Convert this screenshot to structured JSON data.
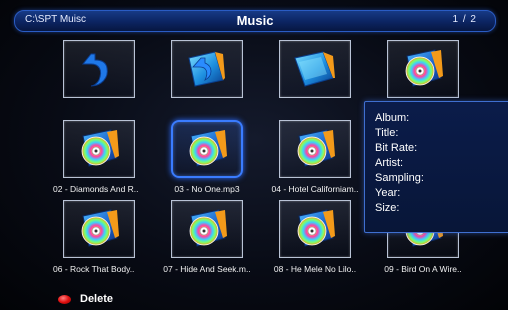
{
  "header": {
    "path": "C:\\SPT Muisc",
    "title": "Music",
    "page_indicator": "1 / 2"
  },
  "grid": {
    "row1": [
      {
        "icon": "back-arrow-icon",
        "label": ""
      },
      {
        "icon": "return-folder-icon",
        "label": ""
      },
      {
        "icon": "folder-icon",
        "label": ""
      },
      {
        "icon": "music-file-icon",
        "label": ""
      }
    ],
    "row2": [
      {
        "icon": "music-file-icon",
        "label": "02 - Diamonds And R.."
      },
      {
        "icon": "music-file-icon",
        "label": "03 - No One.mp3"
      },
      {
        "icon": "music-file-icon",
        "label": "04 - Hotel Californiam.."
      }
    ],
    "row3": [
      {
        "icon": "music-file-icon",
        "label": "06 - Rock That Body.."
      },
      {
        "icon": "music-file-icon",
        "label": "07 - Hide And Seek.m.."
      },
      {
        "icon": "music-file-icon",
        "label": "08 - He Mele No Lilo.."
      },
      {
        "icon": "music-file-icon",
        "label": "09 - Bird On A Wire.."
      }
    ]
  },
  "info_panel": {
    "album": "Album:",
    "title": "Title:",
    "bit_rate": "Bit Rate:",
    "artist": "Artist:",
    "sampling": "Sampling:",
    "year": "Year:",
    "size": "Size:"
  },
  "footer": {
    "delete_label": "Delete"
  },
  "colors": {
    "header_blue": "#0c2461",
    "selection_blue": "#3a7cff",
    "delete_red": "#e01010"
  }
}
